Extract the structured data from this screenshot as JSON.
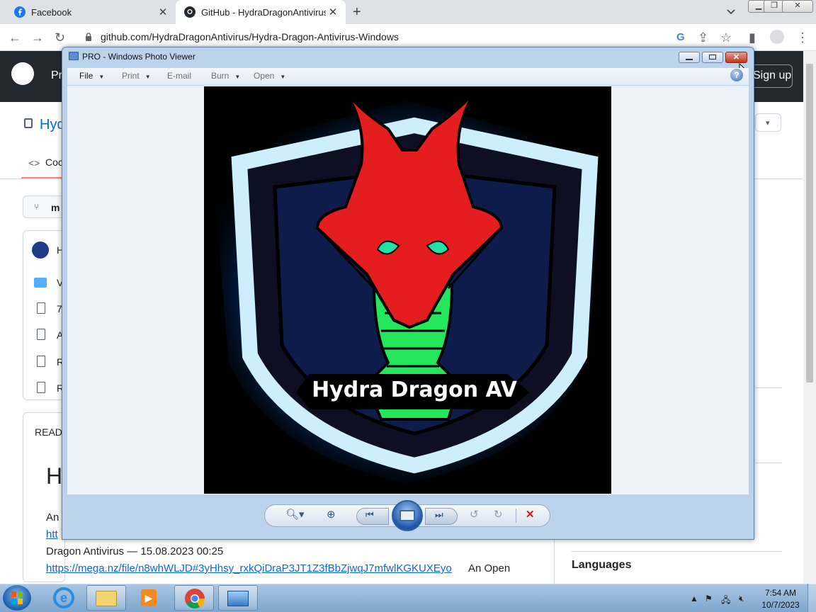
{
  "browser": {
    "tabs": [
      {
        "title": "Facebook"
      },
      {
        "title": "GitHub - HydraDragonAntivirus/("
      }
    ],
    "url": "github.com/HydraDragonAntivirus/Hydra-Dragon-Antivirus-Windows"
  },
  "github": {
    "signup": "Sign up",
    "header_partial": "Pr",
    "repo_partial": "Hyd",
    "code_tab_partial": "Coc",
    "branch_partial": "m",
    "readme_partial": "READ",
    "heading_partial": "H",
    "row_partials": [
      "H",
      "V",
      "7",
      "A",
      "R",
      "R"
    ],
    "readme_line1": "An",
    "readme_line2": "Dragon Antivirus — 15.08.2023 00:25",
    "readme_link": "https://mega.nz/file/n8whWLJD#3yHhsy_rxkQiDraP3JT1Z3fBbZjwqJ7mfwlKGKUXEyo",
    "readme_after_link": "An Open",
    "sidebar_languages": "Languages"
  },
  "photo_viewer": {
    "title": "PRO - Windows Photo Viewer",
    "menu": [
      "File",
      "Print",
      "E-mail",
      "Burn",
      "Open"
    ],
    "image_caption": "Hydra Dragon AV"
  },
  "taskbar": {
    "time": "7:54 AM",
    "date": "10/7/2023"
  }
}
